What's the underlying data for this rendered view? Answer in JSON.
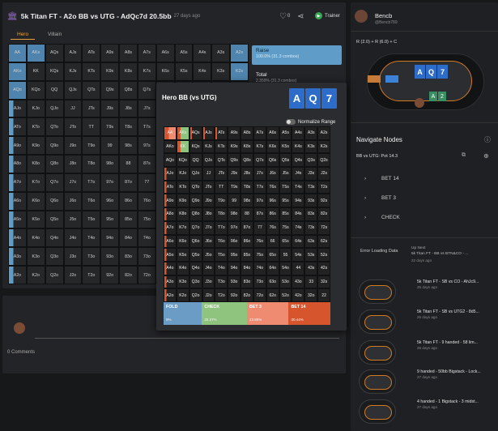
{
  "header": {
    "title": "5k Titan FT - A2o BB vs UTG - AdQc7d 20.5bb",
    "ago": "27 days ago",
    "likes": "0",
    "trainer": "Trainer"
  },
  "tabs": [
    "Hero",
    "Villain"
  ],
  "raise": {
    "label": "Raise",
    "value": "100.0% (31.3 combos)"
  },
  "total": {
    "label": "Total",
    "value": "2.359% (31.3 combos)"
  },
  "grid_cells": [
    "AA",
    "AKs",
    "AQs",
    "AJs",
    "ATs",
    "A9s",
    "A8s",
    "A7s",
    "A6s",
    "A5s",
    "A4s",
    "A3s",
    "A2s",
    "AKo",
    "KK",
    "KQs",
    "KJs",
    "KTs",
    "K9s",
    "K8s",
    "K7s",
    "K6s",
    "K5s",
    "K4s",
    "K3s",
    "K2s",
    "AQo",
    "KQo",
    "QQ",
    "QJs",
    "QTs",
    "Q9s",
    "Q8s",
    "Q7s",
    "Q6s",
    "Q5s",
    "Q4s",
    "Q3s",
    "Q2s",
    "AJo",
    "KJo",
    "QJo",
    "JJ",
    "JTs",
    "J9s",
    "J8s",
    "J7s",
    "J6s",
    "J5s",
    "J4s",
    "J3s",
    "J2s",
    "ATo",
    "KTo",
    "QTo",
    "JTo",
    "TT",
    "T9s",
    "T8s",
    "T7s",
    "T6s",
    "T5s",
    "T4s",
    "T3s",
    "T2s",
    "A9o",
    "K9o",
    "Q9o",
    "J9o",
    "T9o",
    "99",
    "98s",
    "97s",
    "96s",
    "95s",
    "94s",
    "93s",
    "92s",
    "A8o",
    "K8o",
    "Q8o",
    "J8o",
    "T8o",
    "98o",
    "88",
    "87s",
    "86s",
    "85s",
    "84s",
    "83s",
    "82s",
    "A7o",
    "K7o",
    "Q7o",
    "J7o",
    "T7o",
    "97o",
    "87o",
    "77",
    "76s",
    "75s",
    "74s",
    "73s",
    "72s",
    "A6o",
    "K6o",
    "Q6o",
    "J6o",
    "T6o",
    "96o",
    "86o",
    "76o",
    "66",
    "65s",
    "64s",
    "63s",
    "62s",
    "A5o",
    "K5o",
    "Q5o",
    "J5o",
    "T5o",
    "95o",
    "85o",
    "75o",
    "65o",
    "55",
    "54s",
    "53s",
    "52s",
    "A4o",
    "K4o",
    "Q4o",
    "J4o",
    "T4o",
    "94o",
    "84o",
    "74o",
    "64o",
    "54o",
    "44",
    "43s",
    "42s",
    "A3o",
    "K3o",
    "Q3o",
    "J3o",
    "T3o",
    "93o",
    "83o",
    "73o",
    "63o",
    "53o",
    "43o",
    "33",
    "32s",
    "A2o",
    "K2o",
    "Q2o",
    "J2o",
    "T2o",
    "92o",
    "82o",
    "72o",
    "62o",
    "52o",
    "42o",
    "32o",
    "22"
  ],
  "overlay": {
    "title": "Hero BB (vs UTG)",
    "cards": [
      "A",
      "Q",
      "7"
    ],
    "normalize": "Normalize Range",
    "actions": [
      {
        "name": "FOLD",
        "pct": "9%"
      },
      {
        "name": "CHECK",
        "pct": "25.37%"
      },
      {
        "name": "BET 3",
        "pct": "23.88%"
      },
      {
        "name": "BET 14",
        "pct": "30.44%"
      }
    ]
  },
  "comments": {
    "count": "0 Comments"
  },
  "user": {
    "name": "Bencb",
    "handle": "@Bencb789"
  },
  "formula": "R (2.0) + R (6.0) + C",
  "table": {
    "hero_cards": [
      "A",
      "2"
    ],
    "board": [
      "A",
      "Q",
      "7"
    ]
  },
  "navigate": {
    "title": "Navigate Nodes",
    "path": "BB vs UTG: Pot 14.3",
    "items": [
      "BET 14",
      "BET 3",
      "CHECK"
    ]
  },
  "error": "Error Loading Data",
  "hands": [
    {
      "title": "Up Next",
      "sub": "5k Titan FT - BB vs BTN&CO - ...",
      "ago": "22 days ago"
    },
    {
      "title": "5k Titan FT - SB vs CO - AhJc9...",
      "ago": "25 days ago"
    },
    {
      "title": "5k Titan FT - SB vs UTG2 - 8d5...",
      "ago": "25 days ago"
    },
    {
      "title": "5k Titan FT - 9 handed - 58 lim...",
      "ago": "26 days ago"
    },
    {
      "title": "9 handed - 50bb Bigstack - Lock...",
      "ago": "27 days ago"
    },
    {
      "title": "4 handed - 1 Bigstack - 3 midst...",
      "ago": "27 days ago"
    }
  ]
}
